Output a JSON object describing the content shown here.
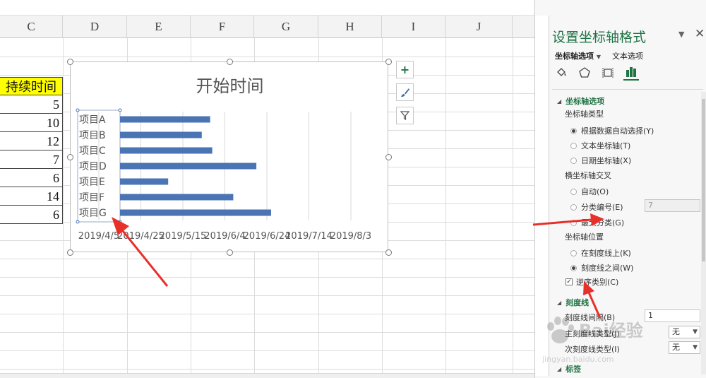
{
  "sheet": {
    "columns": [
      "C",
      "D",
      "E",
      "F",
      "G",
      "H",
      "I",
      "J"
    ],
    "column_c": {
      "header": "持续时间",
      "values": [
        "5",
        "10",
        "12",
        "7",
        "6",
        "14",
        "6"
      ]
    }
  },
  "chart_data": {
    "type": "bar",
    "orientation": "horizontal",
    "title": "开始时间",
    "categories": [
      "项目A",
      "项目B",
      "项目C",
      "项目D",
      "项目E",
      "项目F",
      "项目G"
    ],
    "values": [
      "2019-05-28",
      "2019-05-24",
      "2019-05-29",
      "2019-06-19",
      "2019-05-08",
      "2019-06-08",
      "2019-06-26"
    ],
    "x_tick_labels": [
      "2019/4/5",
      "2019/4/25",
      "2019/5/15",
      "2019/6/4",
      "2019/6/24",
      "2019/7/14",
      "2019/8/3"
    ],
    "xlim": [
      "2019-04-05",
      "2019-08-03"
    ],
    "grid": "vertical",
    "series_color": "#4a74b4"
  },
  "panel": {
    "title": "设置坐标轴格式",
    "tabs": [
      "坐标轴选项",
      "文本选项"
    ],
    "section_axis_options": "坐标轴选项",
    "axis_type_label": "坐标轴类型",
    "axis_type_options": [
      "根据数据自动选择(Y)",
      "文本坐标轴(T)",
      "日期坐标轴(X)"
    ],
    "cross_label": "横坐标轴交叉",
    "cross_options": [
      "自动(O)",
      "分类编号(E)",
      "最大分类(G)"
    ],
    "cross_value": "7",
    "position_label": "坐标轴位置",
    "position_options": [
      "在刻度线上(K)",
      "刻度线之间(W)"
    ],
    "reverse_label": "逆序类别(C)",
    "section_ticks": "刻度线",
    "tick_interval_label": "刻度线间隔(B)",
    "tick_interval_value": "1",
    "major_tick_label": "主刻度线类型(J)",
    "major_tick_value": "无",
    "minor_tick_label": "次刻度线类型(I)",
    "minor_tick_value": "无",
    "section_labels": "标签",
    "accent_color": "#217346"
  },
  "watermark": {
    "text": "Bai经验",
    "url": "jingyan.baidu.com"
  }
}
